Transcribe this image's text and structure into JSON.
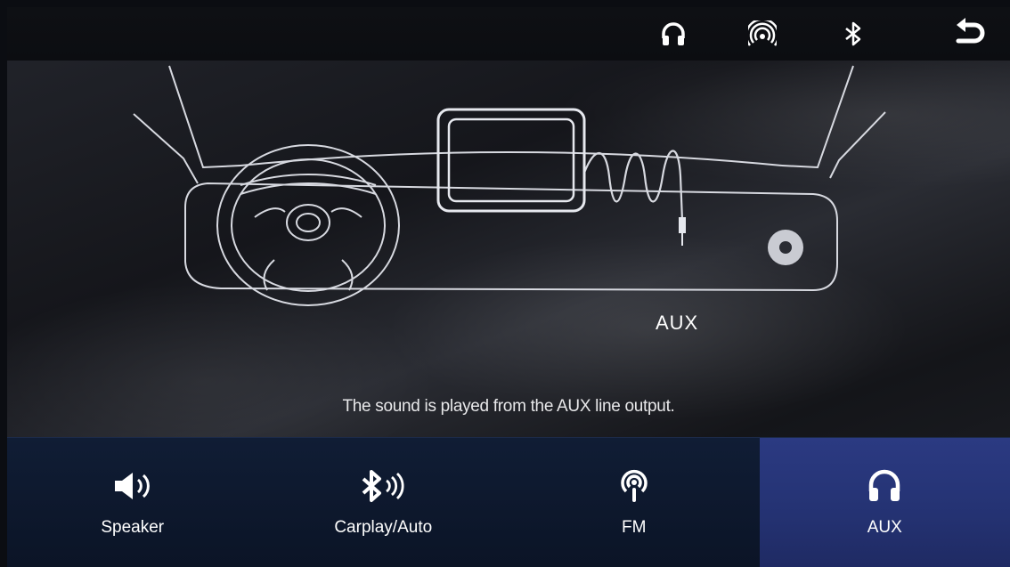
{
  "topbar": {
    "icons": [
      "headphones-icon",
      "radio-broadcast-icon",
      "bluetooth-icon",
      "back-arrow-icon"
    ]
  },
  "illustration": {
    "aux_label": "AUX"
  },
  "message": "The sound is played from the AUX line output.",
  "tabs": [
    {
      "label": "Speaker",
      "icon": "speaker-icon",
      "active": false
    },
    {
      "label": "Carplay/Auto",
      "icon": "bluetooth-audio-icon",
      "active": false
    },
    {
      "label": "FM",
      "icon": "fm-radio-icon",
      "active": false
    },
    {
      "label": "AUX",
      "icon": "headphones-icon",
      "active": true
    }
  ],
  "colors": {
    "active_tab": "#2b3a82",
    "bottom_bar": "#101d35",
    "line_art": "#d7d9e0"
  }
}
